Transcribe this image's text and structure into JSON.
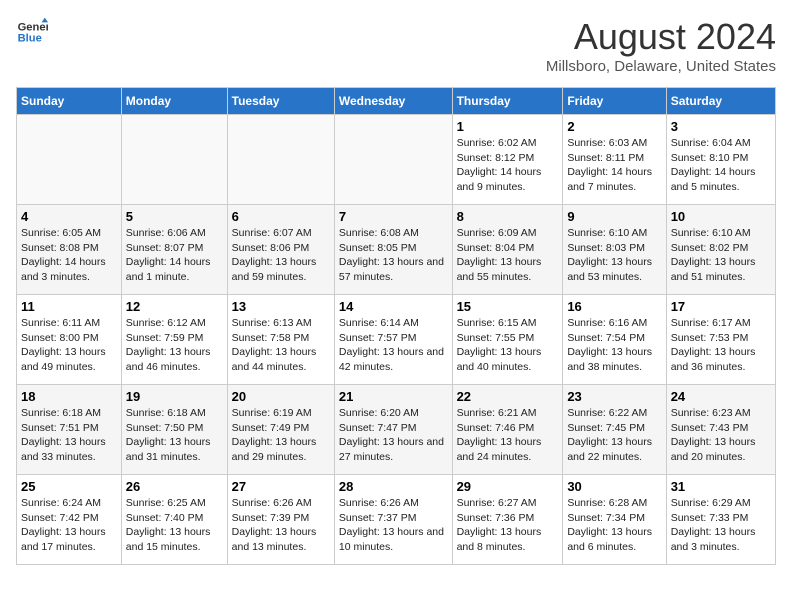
{
  "logo": {
    "line1": "General",
    "line2": "Blue"
  },
  "title": "August 2024",
  "subtitle": "Millsboro, Delaware, United States",
  "days_of_week": [
    "Sunday",
    "Monday",
    "Tuesday",
    "Wednesday",
    "Thursday",
    "Friday",
    "Saturday"
  ],
  "weeks": [
    [
      {
        "day": "",
        "info": ""
      },
      {
        "day": "",
        "info": ""
      },
      {
        "day": "",
        "info": ""
      },
      {
        "day": "",
        "info": ""
      },
      {
        "day": "1",
        "info": "Sunrise: 6:02 AM\nSunset: 8:12 PM\nDaylight: 14 hours and 9 minutes."
      },
      {
        "day": "2",
        "info": "Sunrise: 6:03 AM\nSunset: 8:11 PM\nDaylight: 14 hours and 7 minutes."
      },
      {
        "day": "3",
        "info": "Sunrise: 6:04 AM\nSunset: 8:10 PM\nDaylight: 14 hours and 5 minutes."
      }
    ],
    [
      {
        "day": "4",
        "info": "Sunrise: 6:05 AM\nSunset: 8:08 PM\nDaylight: 14 hours and 3 minutes."
      },
      {
        "day": "5",
        "info": "Sunrise: 6:06 AM\nSunset: 8:07 PM\nDaylight: 14 hours and 1 minute."
      },
      {
        "day": "6",
        "info": "Sunrise: 6:07 AM\nSunset: 8:06 PM\nDaylight: 13 hours and 59 minutes."
      },
      {
        "day": "7",
        "info": "Sunrise: 6:08 AM\nSunset: 8:05 PM\nDaylight: 13 hours and 57 minutes."
      },
      {
        "day": "8",
        "info": "Sunrise: 6:09 AM\nSunset: 8:04 PM\nDaylight: 13 hours and 55 minutes."
      },
      {
        "day": "9",
        "info": "Sunrise: 6:10 AM\nSunset: 8:03 PM\nDaylight: 13 hours and 53 minutes."
      },
      {
        "day": "10",
        "info": "Sunrise: 6:10 AM\nSunset: 8:02 PM\nDaylight: 13 hours and 51 minutes."
      }
    ],
    [
      {
        "day": "11",
        "info": "Sunrise: 6:11 AM\nSunset: 8:00 PM\nDaylight: 13 hours and 49 minutes."
      },
      {
        "day": "12",
        "info": "Sunrise: 6:12 AM\nSunset: 7:59 PM\nDaylight: 13 hours and 46 minutes."
      },
      {
        "day": "13",
        "info": "Sunrise: 6:13 AM\nSunset: 7:58 PM\nDaylight: 13 hours and 44 minutes."
      },
      {
        "day": "14",
        "info": "Sunrise: 6:14 AM\nSunset: 7:57 PM\nDaylight: 13 hours and 42 minutes."
      },
      {
        "day": "15",
        "info": "Sunrise: 6:15 AM\nSunset: 7:55 PM\nDaylight: 13 hours and 40 minutes."
      },
      {
        "day": "16",
        "info": "Sunrise: 6:16 AM\nSunset: 7:54 PM\nDaylight: 13 hours and 38 minutes."
      },
      {
        "day": "17",
        "info": "Sunrise: 6:17 AM\nSunset: 7:53 PM\nDaylight: 13 hours and 36 minutes."
      }
    ],
    [
      {
        "day": "18",
        "info": "Sunrise: 6:18 AM\nSunset: 7:51 PM\nDaylight: 13 hours and 33 minutes."
      },
      {
        "day": "19",
        "info": "Sunrise: 6:18 AM\nSunset: 7:50 PM\nDaylight: 13 hours and 31 minutes."
      },
      {
        "day": "20",
        "info": "Sunrise: 6:19 AM\nSunset: 7:49 PM\nDaylight: 13 hours and 29 minutes."
      },
      {
        "day": "21",
        "info": "Sunrise: 6:20 AM\nSunset: 7:47 PM\nDaylight: 13 hours and 27 minutes."
      },
      {
        "day": "22",
        "info": "Sunrise: 6:21 AM\nSunset: 7:46 PM\nDaylight: 13 hours and 24 minutes."
      },
      {
        "day": "23",
        "info": "Sunrise: 6:22 AM\nSunset: 7:45 PM\nDaylight: 13 hours and 22 minutes."
      },
      {
        "day": "24",
        "info": "Sunrise: 6:23 AM\nSunset: 7:43 PM\nDaylight: 13 hours and 20 minutes."
      }
    ],
    [
      {
        "day": "25",
        "info": "Sunrise: 6:24 AM\nSunset: 7:42 PM\nDaylight: 13 hours and 17 minutes."
      },
      {
        "day": "26",
        "info": "Sunrise: 6:25 AM\nSunset: 7:40 PM\nDaylight: 13 hours and 15 minutes."
      },
      {
        "day": "27",
        "info": "Sunrise: 6:26 AM\nSunset: 7:39 PM\nDaylight: 13 hours and 13 minutes."
      },
      {
        "day": "28",
        "info": "Sunrise: 6:26 AM\nSunset: 7:37 PM\nDaylight: 13 hours and 10 minutes."
      },
      {
        "day": "29",
        "info": "Sunrise: 6:27 AM\nSunset: 7:36 PM\nDaylight: 13 hours and 8 minutes."
      },
      {
        "day": "30",
        "info": "Sunrise: 6:28 AM\nSunset: 7:34 PM\nDaylight: 13 hours and 6 minutes."
      },
      {
        "day": "31",
        "info": "Sunrise: 6:29 AM\nSunset: 7:33 PM\nDaylight: 13 hours and 3 minutes."
      }
    ]
  ]
}
